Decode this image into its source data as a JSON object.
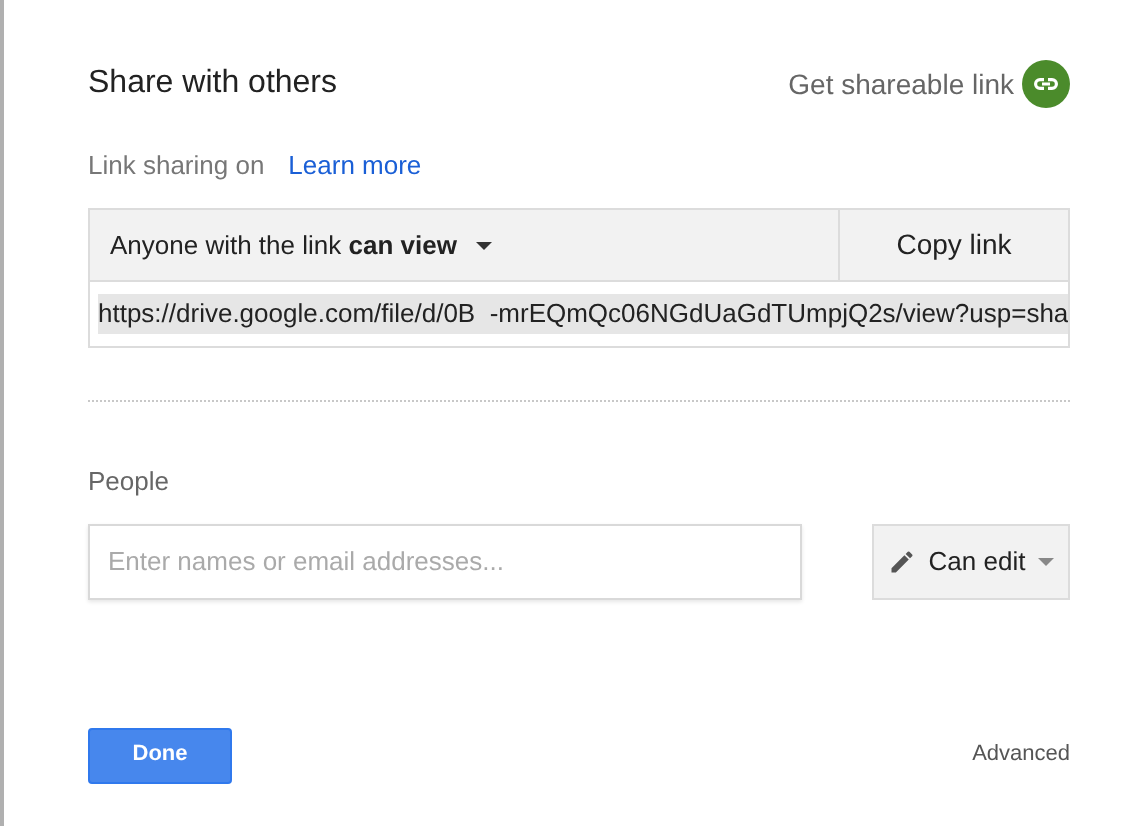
{
  "dialog": {
    "title": "Share with others",
    "shareable_link": "Get shareable link"
  },
  "link_sharing": {
    "status": "Link sharing on",
    "learn_more": "Learn more",
    "access_prefix": "Anyone with the link ",
    "access_level": "can view",
    "copy_button": "Copy link",
    "url": "https://drive.google.com/file/d/0B  -mrEQmQc06NGdUaGdTUmpjQ2s/view?usp=sha",
    "url_selected": true
  },
  "people": {
    "label": "People",
    "placeholder": "Enter names or email addresses...",
    "permission": "Can edit"
  },
  "footer": {
    "done": "Done",
    "advanced": "Advanced"
  }
}
